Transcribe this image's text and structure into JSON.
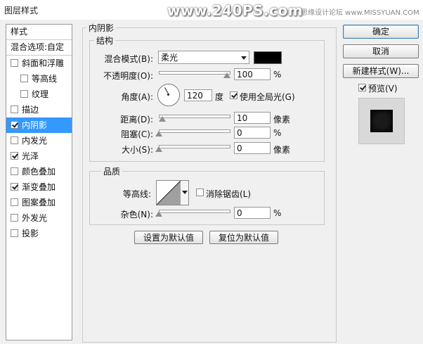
{
  "window": {
    "title": "图层样式",
    "watermark_main": "www.240PS.com",
    "watermark_sub": "思缘设计论坛 www.MISSYUAN.COM"
  },
  "styles_panel": {
    "header": "样式",
    "blend_options": "混合选项:自定",
    "items": [
      {
        "label": "斜面和浮雕",
        "checked": false,
        "sub": false,
        "selected": false
      },
      {
        "label": "等高线",
        "checked": false,
        "sub": true,
        "selected": false
      },
      {
        "label": "纹理",
        "checked": false,
        "sub": true,
        "selected": false
      },
      {
        "label": "描边",
        "checked": false,
        "sub": false,
        "selected": false
      },
      {
        "label": "内阴影",
        "checked": true,
        "sub": false,
        "selected": true
      },
      {
        "label": "内发光",
        "checked": false,
        "sub": false,
        "selected": false
      },
      {
        "label": "光泽",
        "checked": true,
        "sub": false,
        "selected": false
      },
      {
        "label": "颜色叠加",
        "checked": false,
        "sub": false,
        "selected": false
      },
      {
        "label": "渐变叠加",
        "checked": true,
        "sub": false,
        "selected": false
      },
      {
        "label": "图案叠加",
        "checked": false,
        "sub": false,
        "selected": false
      },
      {
        "label": "外发光",
        "checked": false,
        "sub": false,
        "selected": false
      },
      {
        "label": "投影",
        "checked": false,
        "sub": false,
        "selected": false
      }
    ]
  },
  "inner_shadow": {
    "section_title": "内阴影",
    "structure": {
      "title": "结构",
      "blend_mode_label": "混合模式(B):",
      "blend_mode_value": "柔光",
      "color": "#000000",
      "opacity_label": "不透明度(O):",
      "opacity_value": "100",
      "opacity_unit": "%",
      "opacity_fraction": 1.0,
      "angle_label": "角度(A):",
      "angle_value": "120",
      "angle_unit": "度",
      "global_light_label": "使用全局光(G)",
      "global_light_checked": true,
      "distance_label": "距离(D):",
      "distance_value": "10",
      "distance_unit": "像素",
      "distance_fraction": 0.04,
      "choke_label": "阻塞(C):",
      "choke_value": "0",
      "choke_unit": "%",
      "choke_fraction": 0,
      "size_label": "大小(S):",
      "size_value": "0",
      "size_unit": "像素",
      "size_fraction": 0
    },
    "quality": {
      "title": "品质",
      "contour_label": "等高线:",
      "anti_alias_label": "消除锯齿(L)",
      "anti_alias_checked": false,
      "noise_label": "杂色(N):",
      "noise_value": "0",
      "noise_unit": "%",
      "noise_fraction": 0
    },
    "make_default": "设置为默认值",
    "reset_default": "复位为默认值"
  },
  "actions": {
    "ok": "确定",
    "cancel": "取消",
    "new_style": "新建样式(W)...",
    "preview_label": "预览(V)",
    "preview_checked": true
  }
}
